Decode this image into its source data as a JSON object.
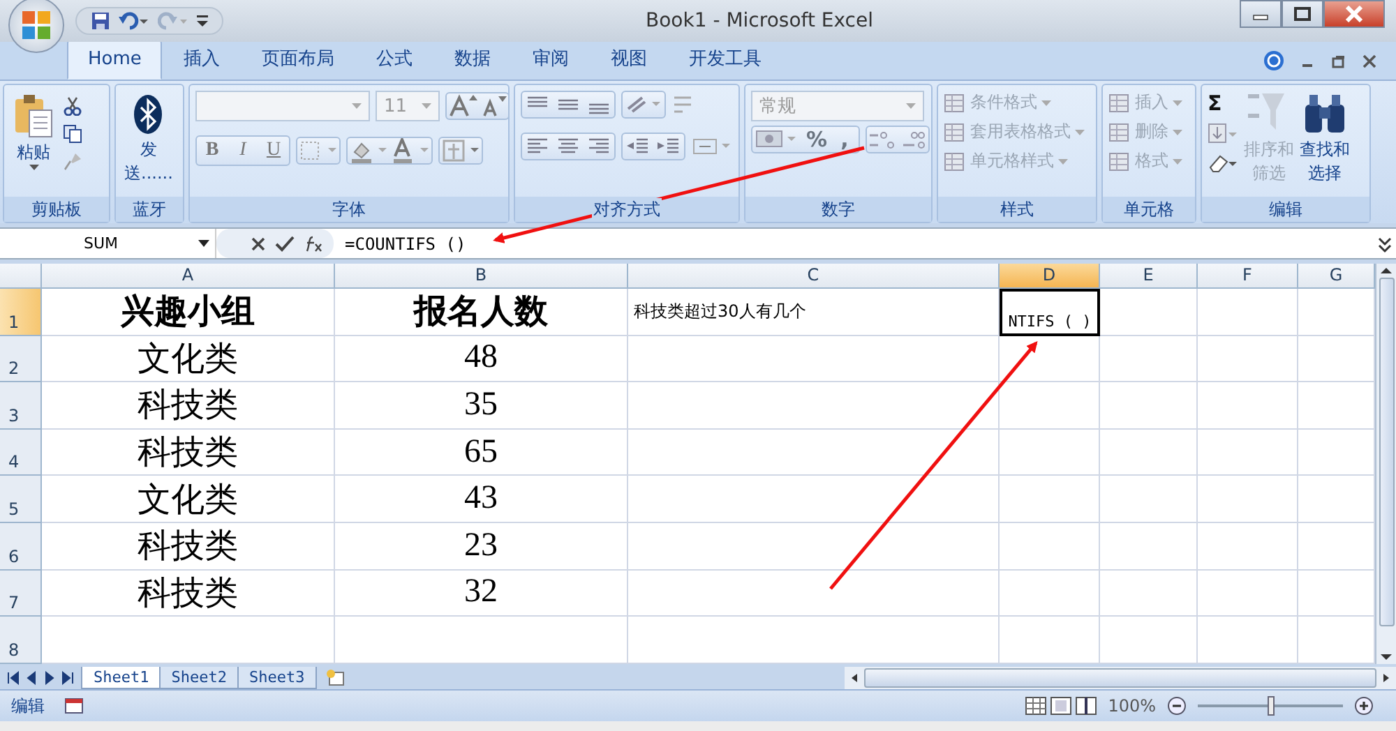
{
  "window": {
    "title": "Book1 - Microsoft Excel"
  },
  "tabs": [
    {
      "label": "Home",
      "selected": true
    },
    {
      "label": "插入",
      "selected": false
    },
    {
      "label": "页面布局",
      "selected": false
    },
    {
      "label": "公式",
      "selected": false
    },
    {
      "label": "数据",
      "selected": false
    },
    {
      "label": "审阅",
      "selected": false
    },
    {
      "label": "视图",
      "selected": false
    },
    {
      "label": "开发工具",
      "selected": false
    }
  ],
  "ribbon": [
    {
      "kind": "clipboard",
      "label": "剪贴板",
      "button": "粘贴"
    },
    {
      "kind": "bluetooth",
      "label": "蓝牙",
      "button_lines": [
        "发",
        "送......"
      ]
    },
    {
      "kind": "font",
      "label": "字体",
      "size": "11",
      "style_buttons": [
        "B",
        "I",
        "U"
      ]
    },
    {
      "kind": "alignment",
      "label": "对齐方式"
    },
    {
      "kind": "number",
      "label": "数字",
      "format": "常规",
      "symbols": [
        "%",
        ","
      ]
    },
    {
      "kind": "list",
      "label": "样式",
      "items": [
        {
          "label": "条件格式",
          "disabled": true
        },
        {
          "label": "套用表格格式",
          "disabled": true
        },
        {
          "label": "单元格样式",
          "disabled": true
        }
      ]
    },
    {
      "kind": "list",
      "label": "单元格",
      "items": [
        {
          "label": "插入",
          "disabled": true
        },
        {
          "label": "删除",
          "disabled": true
        },
        {
          "label": "格式",
          "disabled": true
        }
      ]
    },
    {
      "kind": "editing",
      "label": "编辑",
      "sigma": "Σ",
      "buttons": [
        {
          "lines": [
            "排序和",
            "筛选"
          ],
          "disabled": true
        },
        {
          "lines": [
            "查找和",
            "选择"
          ],
          "disabled": false
        }
      ]
    }
  ],
  "formula_bar": {
    "name_box": "SUM",
    "formula": "=COUNTIFS ()"
  },
  "columns": [
    {
      "label": "A",
      "selected": false
    },
    {
      "label": "B",
      "selected": false
    },
    {
      "label": "C",
      "selected": false
    },
    {
      "label": "D",
      "selected": true
    },
    {
      "label": "E",
      "selected": false
    },
    {
      "label": "F",
      "selected": false
    },
    {
      "label": "G",
      "selected": false
    }
  ],
  "rows": [
    {
      "header": "1",
      "bold": true,
      "cells": {
        "A": {
          "text": "兴趣小组",
          "selected": false
        },
        "B": {
          "text": "报名人数",
          "selected": false
        },
        "C": {
          "text": "科技类超过30人有几个",
          "selected": false
        },
        "D": {
          "text": "NTIFS ( )",
          "selected": true
        }
      }
    },
    {
      "header": "2",
      "bold": false,
      "cells": {
        "A": {
          "text": "文化类",
          "selected": false
        },
        "B": {
          "text": "48",
          "selected": false
        }
      }
    },
    {
      "header": "3",
      "bold": false,
      "cells": {
        "A": {
          "text": "科技类",
          "selected": false
        },
        "B": {
          "text": "35",
          "selected": false
        }
      }
    },
    {
      "header": "4",
      "bold": false,
      "cells": {
        "A": {
          "text": "科技类",
          "selected": false
        },
        "B": {
          "text": "65",
          "selected": false
        }
      }
    },
    {
      "header": "5",
      "bold": false,
      "cells": {
        "A": {
          "text": "文化类",
          "selected": false
        },
        "B": {
          "text": "43",
          "selected": false
        }
      }
    },
    {
      "header": "6",
      "bold": false,
      "cells": {
        "A": {
          "text": "科技类",
          "selected": false
        },
        "B": {
          "text": "23",
          "selected": false
        }
      }
    },
    {
      "header": "7",
      "bold": false,
      "cells": {
        "A": {
          "text": "科技类",
          "selected": false
        },
        "B": {
          "text": "32",
          "selected": false
        }
      }
    },
    {
      "header": "8",
      "cells": {}
    }
  ],
  "sheets": [
    {
      "label": "Sheet1",
      "selected": true
    },
    {
      "label": "Sheet2",
      "selected": false
    },
    {
      "label": "Sheet3",
      "selected": false
    }
  ],
  "status_bar": {
    "mode": "编辑",
    "zoom": "100%",
    "zoom_slider": {
      "level": 0.5
    }
  }
}
